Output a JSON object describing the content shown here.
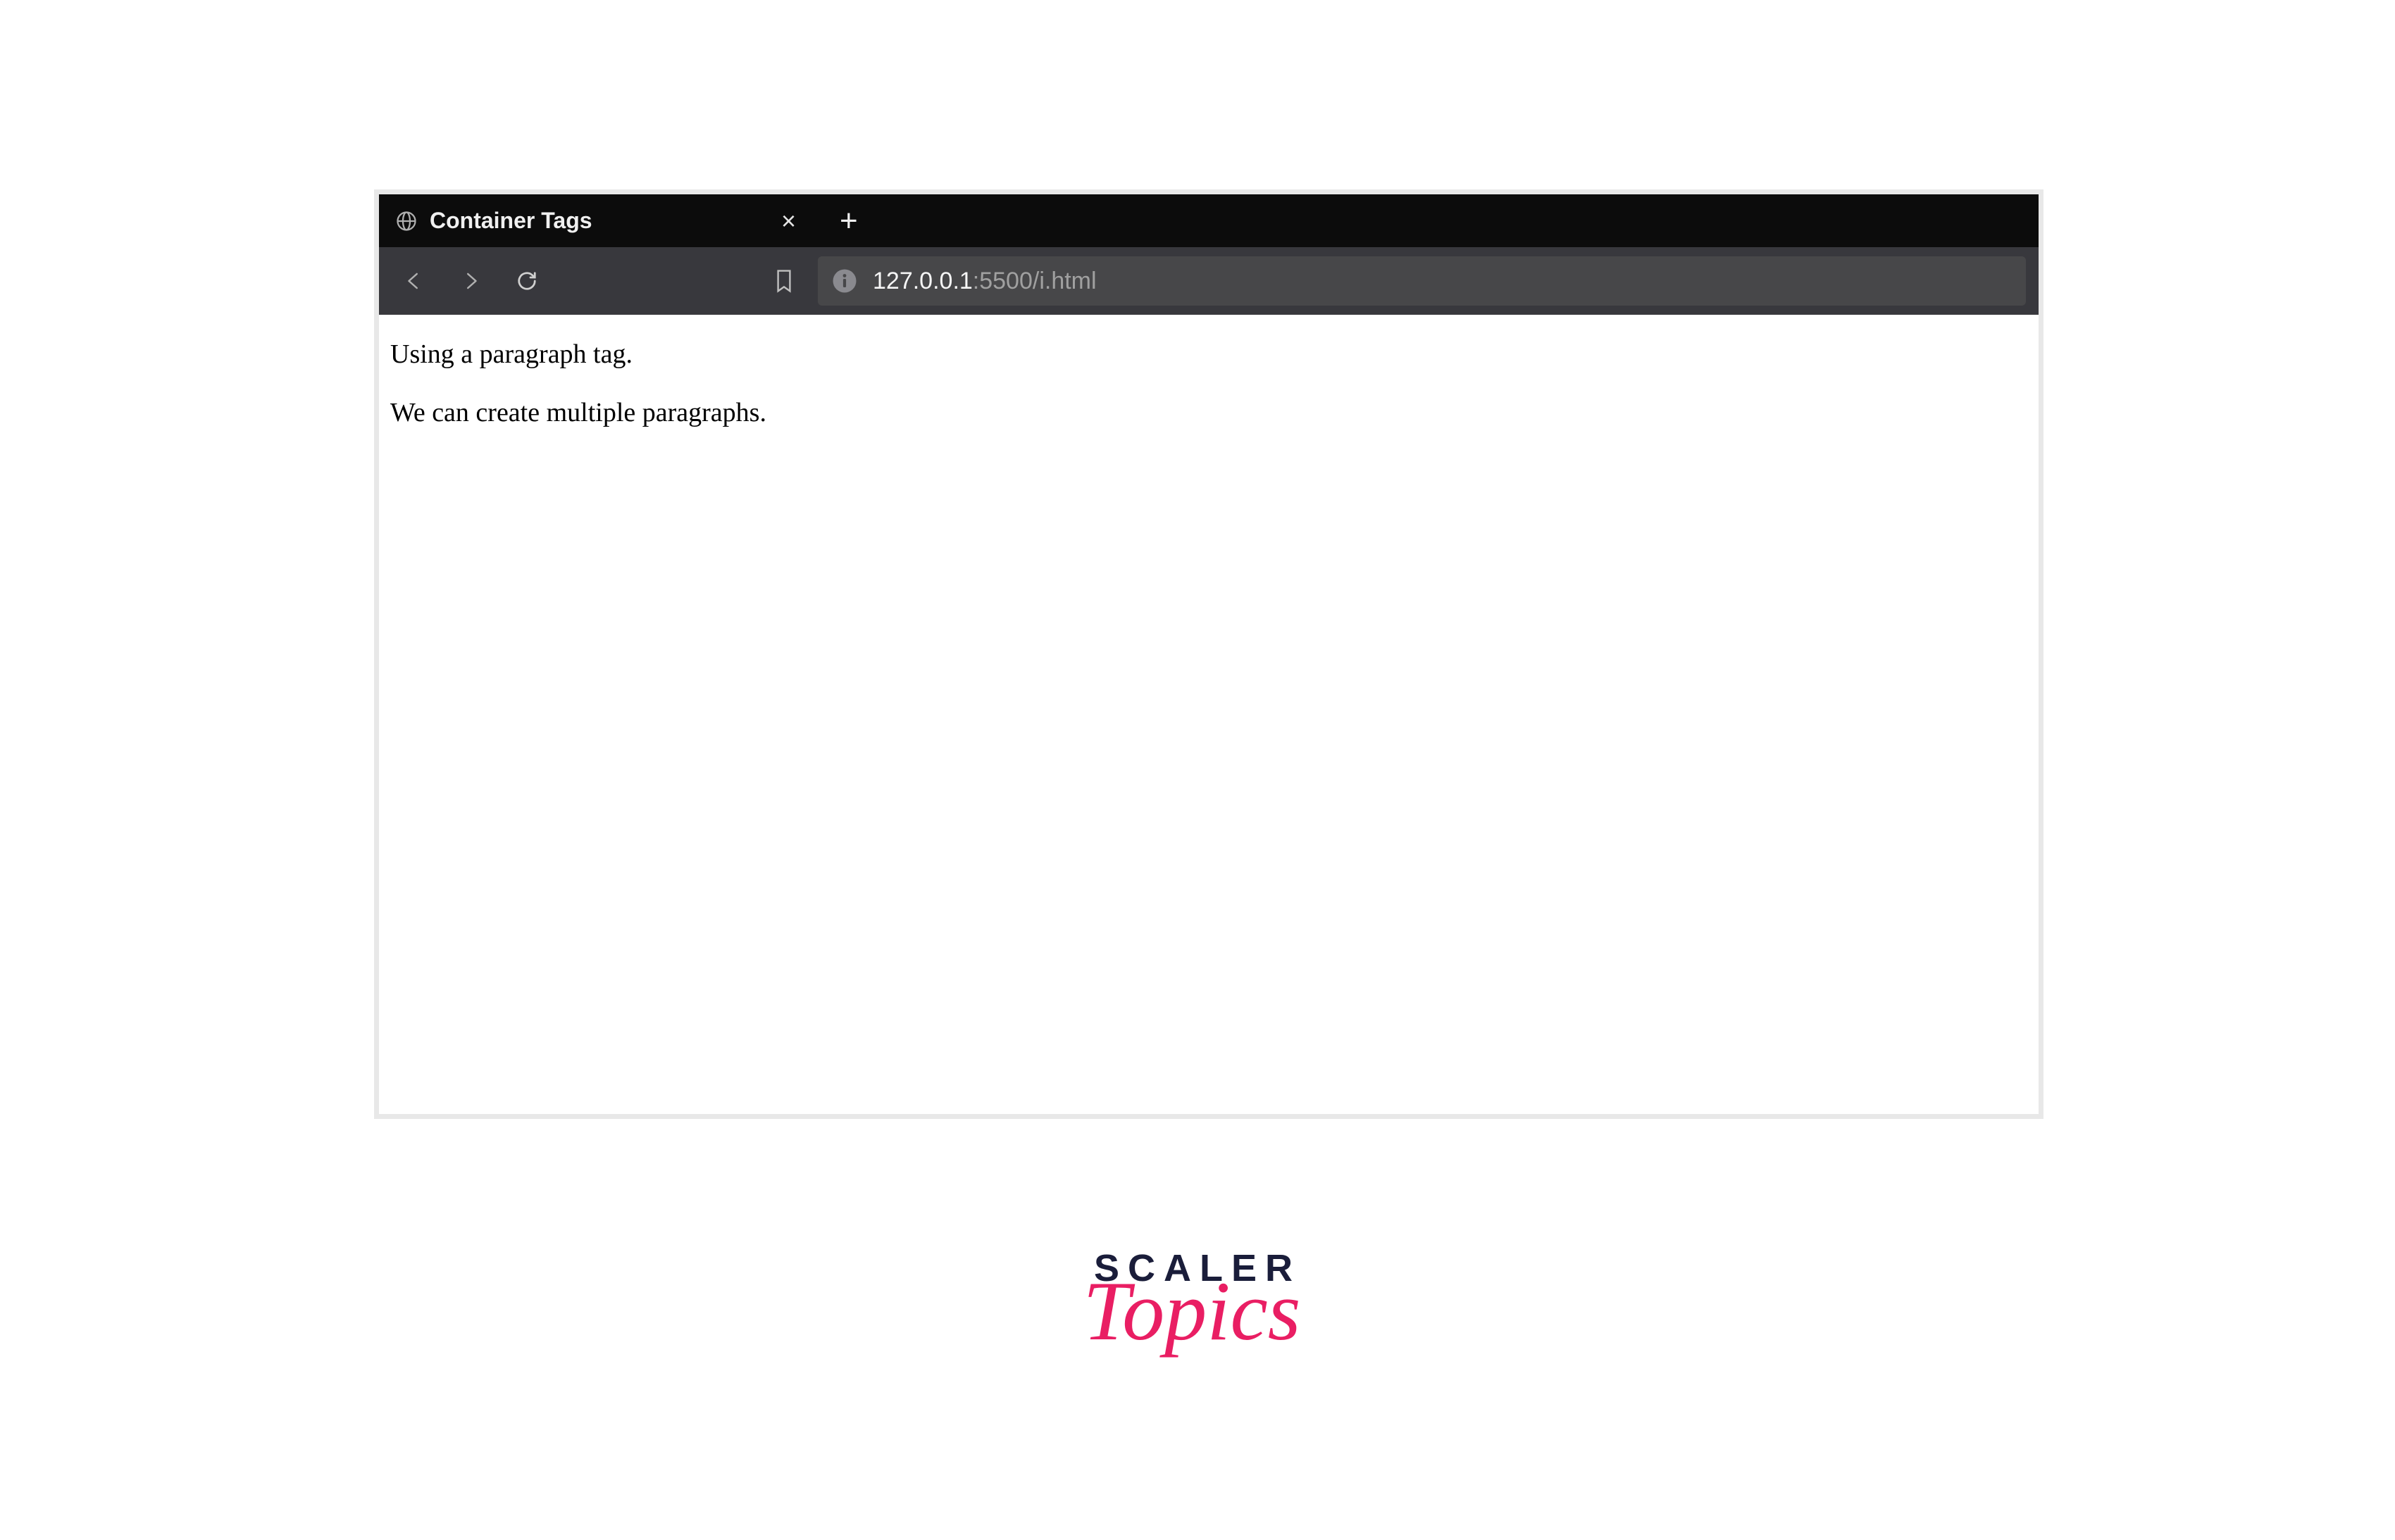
{
  "browser": {
    "tab": {
      "title": "Container Tags",
      "favicon": "globe-icon"
    },
    "address": {
      "host": "127.0.0.1",
      "path": ":5500/i.html"
    }
  },
  "page": {
    "paragraph1": "Using a paragraph tag.",
    "paragraph2": "We can create multiple paragraphs."
  },
  "watermark": {
    "line1": "SCALER",
    "line2": "Topics"
  }
}
